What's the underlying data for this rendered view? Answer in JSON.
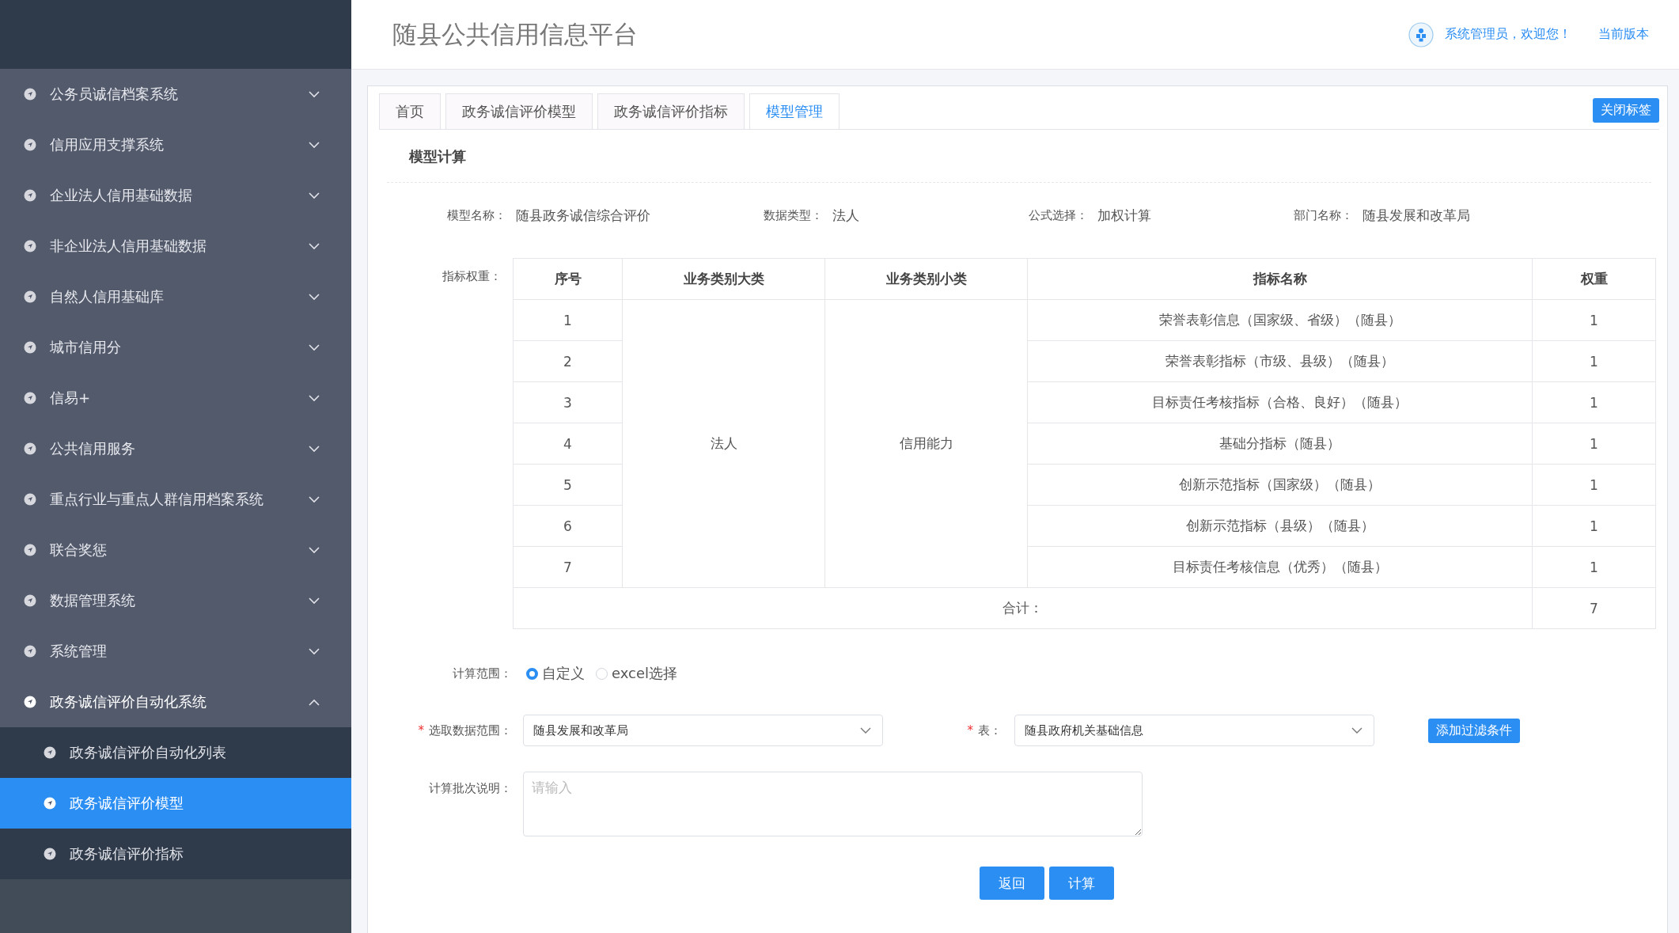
{
  "sidebar": {
    "items": [
      {
        "label": "公务员诚信档案系统",
        "expanded": false,
        "selected": false
      },
      {
        "label": "信用应用支撑系统",
        "expanded": false,
        "selected": false
      },
      {
        "label": "企业法人信用基础数据",
        "expanded": false,
        "selected": false
      },
      {
        "label": "非企业法人信用基础数据",
        "expanded": false,
        "selected": false
      },
      {
        "label": "自然人信用基础库",
        "expanded": false,
        "selected": false
      },
      {
        "label": "城市信用分",
        "expanded": false,
        "selected": false
      },
      {
        "label": "信易+",
        "expanded": false,
        "selected": false
      },
      {
        "label": "公共信用服务",
        "expanded": false,
        "selected": false
      },
      {
        "label": "重点行业与重点人群信用档案系统",
        "expanded": false,
        "selected": false
      },
      {
        "label": "联合奖惩",
        "expanded": false,
        "selected": false
      },
      {
        "label": "数据管理系统",
        "expanded": false,
        "selected": false
      },
      {
        "label": "系统管理",
        "expanded": false,
        "selected": false
      },
      {
        "label": "政务诚信评价自动化系统",
        "expanded": true,
        "selected": false,
        "children": [
          {
            "label": "政务诚信评价自动化列表",
            "selected": false
          },
          {
            "label": "政务诚信评价模型",
            "selected": true
          },
          {
            "label": "政务诚信评价指标",
            "selected": false
          }
        ]
      }
    ]
  },
  "header": {
    "title": "随县公共信用信息平台",
    "user": "系统管理员，欢迎您！",
    "version_link": "当前版本"
  },
  "tabs": [
    {
      "label": "首页",
      "selected": false
    },
    {
      "label": "政务诚信评价模型",
      "selected": false
    },
    {
      "label": "政务诚信评价指标",
      "selected": false
    },
    {
      "label": "模型管理",
      "selected": true
    }
  ],
  "close_tabs_button": "关闭标签",
  "section_title": "模型计算",
  "info": [
    {
      "label": "模型名称：",
      "value": "随县政务诚信综合评价"
    },
    {
      "label": "数据类型：",
      "value": "法人"
    },
    {
      "label": "公式选择：",
      "value": "加权计算"
    },
    {
      "label": "部门名称：",
      "value": "随县发展和改革局"
    }
  ],
  "weights_label": "指标权重：",
  "table": {
    "columns": [
      "序号",
      "业务类别大类",
      "业务类别小类",
      "指标名称",
      "权重"
    ],
    "category": "法人",
    "subcategory": "信用能力",
    "rows": [
      {
        "index": "1",
        "name": "荣誉表彰信息（国家级、省级）（随县）",
        "weight": "1"
      },
      {
        "index": "2",
        "name": "荣誉表彰指标（市级、县级）（随县）",
        "weight": "1"
      },
      {
        "index": "3",
        "name": "目标责任考核指标（合格、良好）（随县）",
        "weight": "1"
      },
      {
        "index": "4",
        "name": "基础分指标（随县）",
        "weight": "1"
      },
      {
        "index": "5",
        "name": "创新示范指标（国家级）（随县）",
        "weight": "1"
      },
      {
        "index": "6",
        "name": "创新示范指标（县级）（随县）",
        "weight": "1"
      },
      {
        "index": "7",
        "name": "目标责任考核信息（优秀）（随县）",
        "weight": "1"
      }
    ],
    "total_label": "合计：",
    "total": "7"
  },
  "scope": {
    "label": "计算范围：",
    "options": [
      {
        "label": "自定义",
        "selected": true
      },
      {
        "label": "excel选择",
        "selected": false
      }
    ]
  },
  "data_range": {
    "required_mark": "*",
    "label": "选取数据范围：",
    "value": "随县发展和改革局"
  },
  "table_select": {
    "required_mark": "*",
    "label": "表：",
    "value": "随县政府机关基础信息"
  },
  "add_filter_button": "添加过滤条件",
  "batch_note": {
    "label": "计算批次说明：",
    "placeholder": "请输入"
  },
  "buttons": [
    "返回",
    "计算"
  ]
}
